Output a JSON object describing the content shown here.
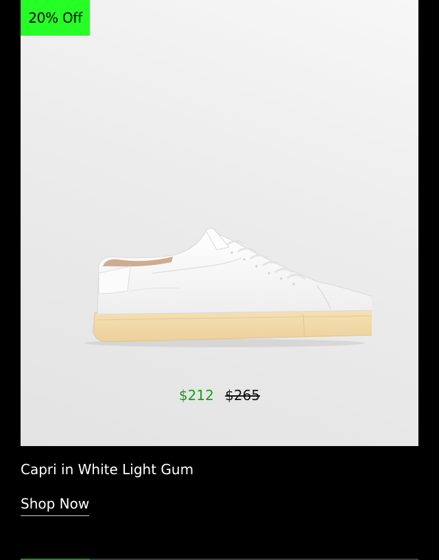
{
  "product": {
    "badge": "20% Off",
    "sale_price": "$212",
    "original_price": "$265",
    "name": "Capri in White Light Gum",
    "cta_label": "Shop Now",
    "image_icon": "sneaker-image"
  },
  "colors": {
    "badge_bg": "#25ff25",
    "sale_price": "#13a313",
    "page_bg": "#000000",
    "card_bg": "#ececec",
    "sole": "#f2d9a6"
  }
}
